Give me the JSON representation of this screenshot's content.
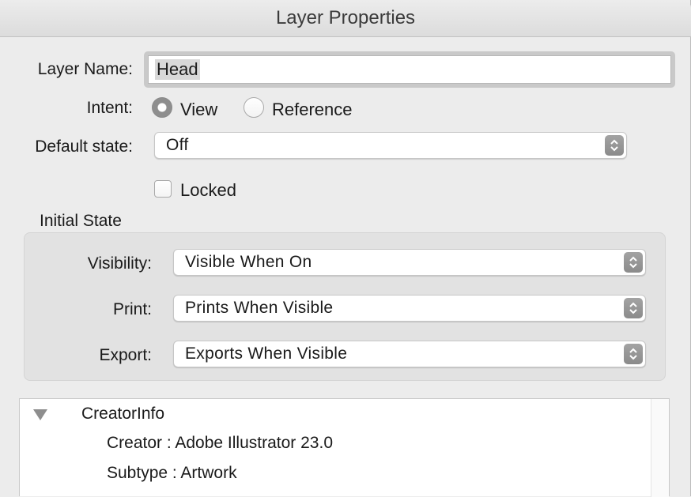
{
  "window": {
    "title": "Layer Properties"
  },
  "form": {
    "layer_name_label": "Layer Name:",
    "layer_name_value": "Head",
    "intent_label": "Intent:",
    "intent_options": [
      "View",
      "Reference"
    ],
    "intent_selected": "View",
    "default_state_label": "Default state:",
    "default_state_value": "Off",
    "locked_label": "Locked",
    "locked_checked": false
  },
  "initial_state": {
    "group_label": "Initial State",
    "visibility_label": "Visibility:",
    "visibility_value": "Visible When On",
    "print_label": "Print:",
    "print_value": "Prints When Visible",
    "export_label": "Export:",
    "export_value": "Exports When Visible"
  },
  "tree": {
    "root_label": "CreatorInfo",
    "root_expanded": true,
    "children": [
      {
        "text": "Creator : Adobe Illustrator 23.0"
      },
      {
        "text": "Subtype : Artwork"
      }
    ]
  },
  "icons": {
    "disclosure": "disclosure-triangle-down-icon",
    "stepper": "up-down-chevrons-icon"
  },
  "colors": {
    "window_bg": "#ececec",
    "group_bg": "#e2e2e2",
    "stepper": "#999999"
  }
}
